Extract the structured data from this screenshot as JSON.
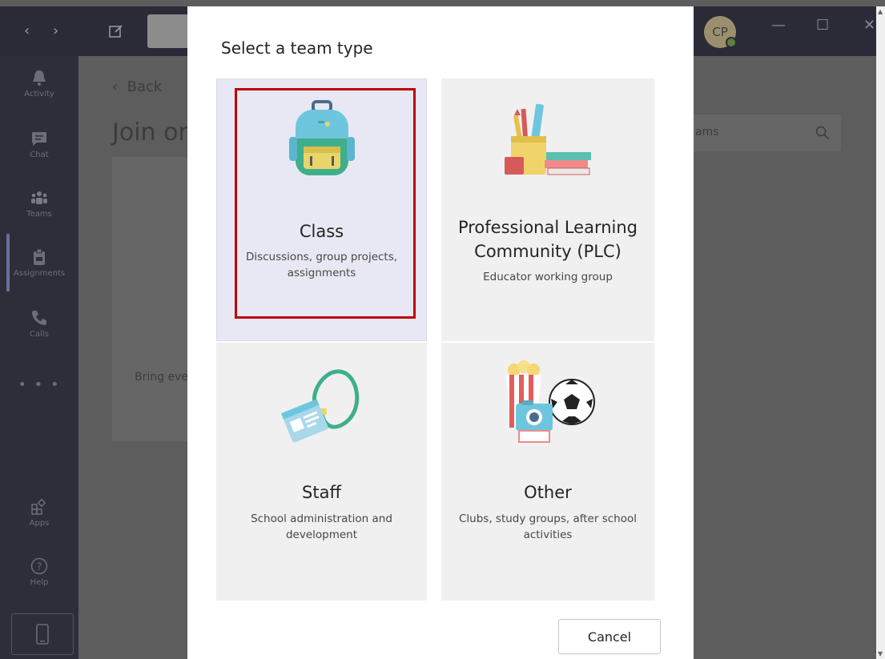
{
  "titlebar": {
    "avatar_initials": "CP"
  },
  "rail": {
    "items": [
      {
        "label": "Activity",
        "icon": "bell-icon"
      },
      {
        "label": "Chat",
        "icon": "chat-icon"
      },
      {
        "label": "Teams",
        "icon": "teams-icon"
      },
      {
        "label": "Assignments",
        "icon": "assignments-icon"
      },
      {
        "label": "Calls",
        "icon": "phone-icon"
      },
      {
        "label": "Apps",
        "icon": "apps-icon"
      },
      {
        "label": "Help",
        "icon": "help-icon"
      }
    ],
    "more_label": "• • •"
  },
  "background": {
    "back_label": "Back",
    "page_title": "Join or",
    "card_text": "Bring eve",
    "search_placeholder": "ams"
  },
  "modal": {
    "title": "Select a team type",
    "cards": [
      {
        "name": "Class",
        "description": "Discussions, group projects, assignments",
        "icon": "backpack-icon",
        "selected": true
      },
      {
        "name": "Professional Learning Community (PLC)",
        "description": "Educator working group",
        "icon": "books-pencils-icon",
        "selected": false
      },
      {
        "name": "Staff",
        "description": "School administration and development",
        "icon": "lanyard-badge-icon",
        "selected": false
      },
      {
        "name": "Other",
        "description": "Clubs, study groups, after school activities",
        "icon": "popcorn-soccer-icon",
        "selected": false
      }
    ],
    "cancel_label": "Cancel"
  },
  "colors": {
    "highlight": "#c00000",
    "rail": "#2e2e3a",
    "overlay": "#5d5d5d"
  }
}
